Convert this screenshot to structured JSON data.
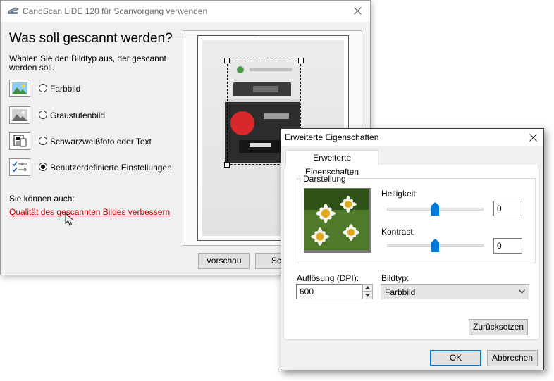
{
  "scan_dialog": {
    "title": "CanoScan LiDE 120 für Scanvorgang verwenden",
    "heading": "Was soll gescannt werden?",
    "hint": "Wählen Sie den Bildtyp aus, der gescannt werden soll.",
    "picture_types": [
      {
        "label": "Farbbild",
        "icon": "color-picture-icon",
        "checked": false
      },
      {
        "label": "Graustufenbild",
        "icon": "grayscale-picture-icon",
        "checked": false
      },
      {
        "label": "Schwarzweißfoto oder Text",
        "icon": "black-white-text-icon",
        "checked": false
      },
      {
        "label": "Benutzerdefinierte Einstellungen",
        "icon": "custom-settings-icon",
        "checked": true
      }
    ],
    "also_label": "Sie können auch:",
    "quality_link": "Qualität des gescannten Bildes verbessern",
    "preview_button": "Vorschau",
    "scan_button": "Scan"
  },
  "props_dialog": {
    "title": "Erweiterte Eigenschaften",
    "tab_label": "Erweiterte Eigenschaften",
    "group_label": "Darstellung",
    "brightness_label": "Helligkeit:",
    "brightness_value": "0",
    "contrast_label": "Kontrast:",
    "contrast_value": "0",
    "resolution_label": "Auflösung (DPI):",
    "resolution_value": "600",
    "picture_type_label": "Bildtyp:",
    "picture_type_value": "Farbbild",
    "reset_button": "Zurücksetzen",
    "ok_button": "OK",
    "cancel_button": "Abbrechen"
  },
  "colors": {
    "link": "#c00000",
    "default_button_border": "#0078d7",
    "slider_thumb": "#0078d7"
  }
}
